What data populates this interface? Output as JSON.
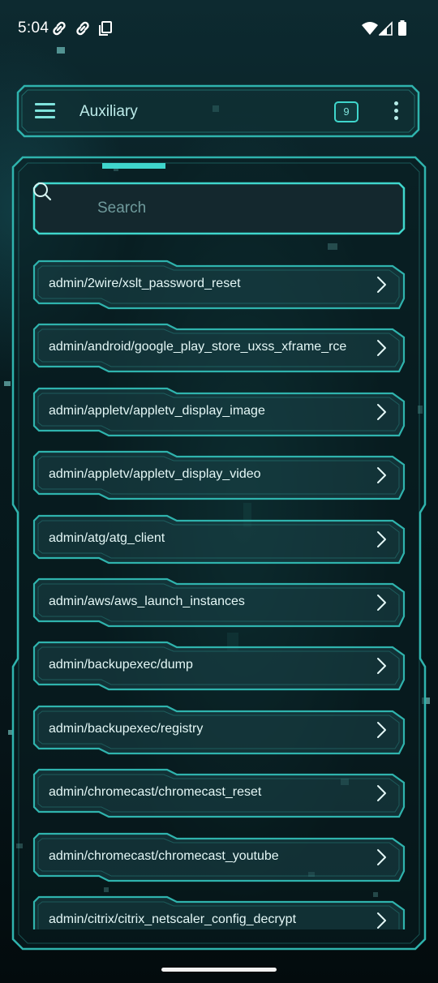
{
  "status_bar": {
    "time": "5:04"
  },
  "app_bar": {
    "title": "Auxiliary",
    "badge_count": "9"
  },
  "search": {
    "placeholder": "Search"
  },
  "modules": [
    "admin/2wire/xslt_password_reset",
    "admin/android/google_play_store_uxss_xframe_rce",
    "admin/appletv/appletv_display_image",
    "admin/appletv/appletv_display_video",
    "admin/atg/atg_client",
    "admin/aws/aws_launch_instances",
    "admin/backupexec/dump",
    "admin/backupexec/registry",
    "admin/chromecast/chromecast_reset",
    "admin/chromecast/chromecast_youtube",
    "admin/citrix/citrix_netscaler_config_decrypt"
  ],
  "colors": {
    "accent": "#3fd6cc",
    "frame_stroke": "#2fb3ad",
    "panel_fill": "#0b2326",
    "background": "#071a1e"
  },
  "icons": {
    "status": [
      "link-icon",
      "link-icon",
      "copy-icon",
      "wifi-icon",
      "signal-icon",
      "battery-icon"
    ],
    "menu": "hamburger-menu-icon",
    "overflow": "more-vert-icon",
    "search": "search-icon",
    "row": "chevron-right-icon"
  }
}
